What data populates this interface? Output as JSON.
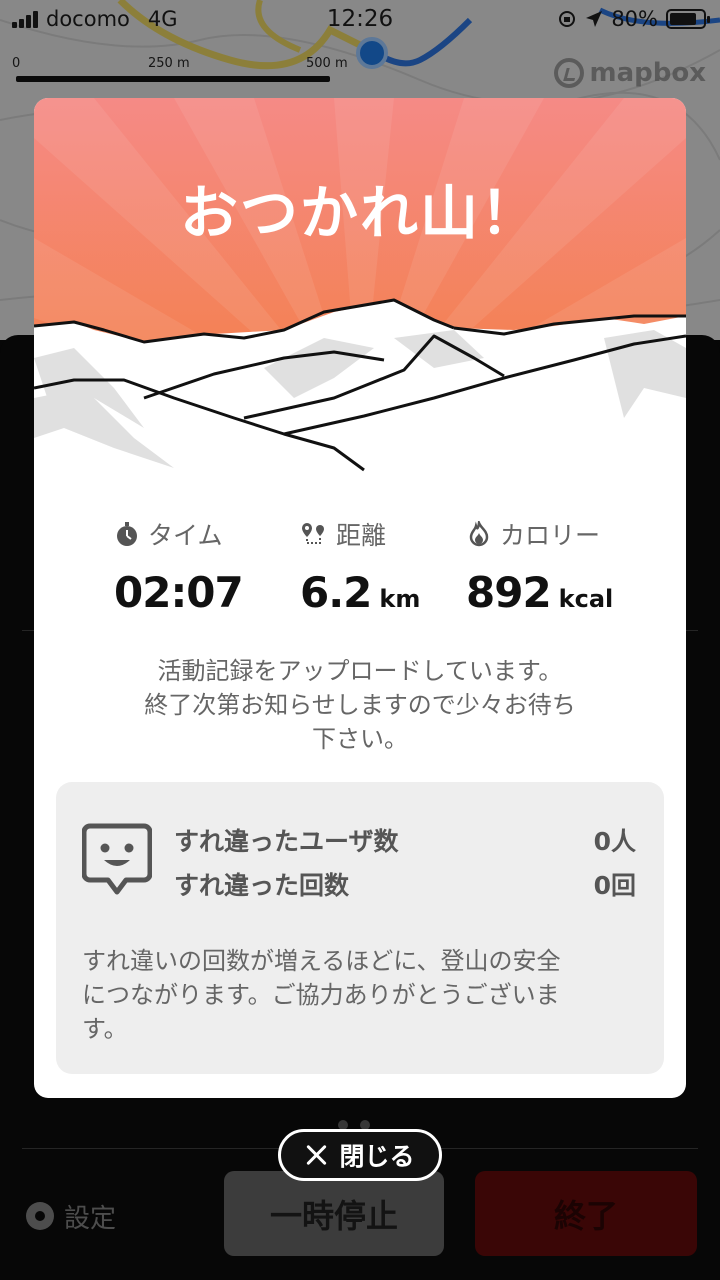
{
  "status_bar": {
    "carrier": "docomo",
    "network": "4G",
    "time": "12:26",
    "battery": "80%",
    "battery_level": 0.8
  },
  "map": {
    "scale_labels": [
      "0",
      "250 m",
      "500 m"
    ],
    "attribution": "mapbox"
  },
  "modal": {
    "title": "おつかれ山！",
    "stats": [
      {
        "label": "タイム",
        "value": "02:07",
        "unit": "",
        "icon": "stopwatch-icon"
      },
      {
        "label": "距離",
        "value": "6.2",
        "unit": "km",
        "icon": "route-pin-icon"
      },
      {
        "label": "カロリー",
        "value": "892",
        "unit": "kcal",
        "icon": "flame-icon"
      }
    ],
    "upload_message_lines": [
      "活動記録をアップロードしています。",
      "終了次第お知らせしますので少々お待ち",
      "下さい。"
    ],
    "encounters": {
      "users_label": "すれ違ったユーザ数",
      "users_value": "0人",
      "count_label": "すれ違った回数",
      "count_value": "0回",
      "note_lines": [
        "すれ違いの回数が増えるほどに、登山の安全",
        "につながります。ご協力ありがとうございま",
        "す。"
      ]
    },
    "close_label": "閉じる"
  },
  "bottom_bar": {
    "settings_label": "設定",
    "pause_label": "一時停止",
    "end_label": "終了"
  },
  "colors": {
    "hero_top": "#f58a86",
    "hero_bottom": "#f47d3a",
    "end_button": "#5a0a0a",
    "location_dot": "#1d6fd1"
  }
}
